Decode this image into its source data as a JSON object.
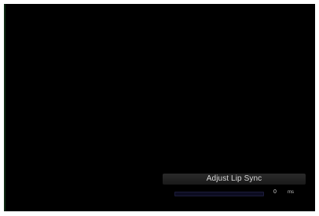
{
  "osd": {
    "title": "Adjust Lip Sync",
    "value": "0",
    "unit": "ms",
    "slider_level": 0.0
  },
  "colors": {
    "background": "#000000",
    "slider_track": "#0c0c20",
    "text": "#d8d8d8"
  }
}
